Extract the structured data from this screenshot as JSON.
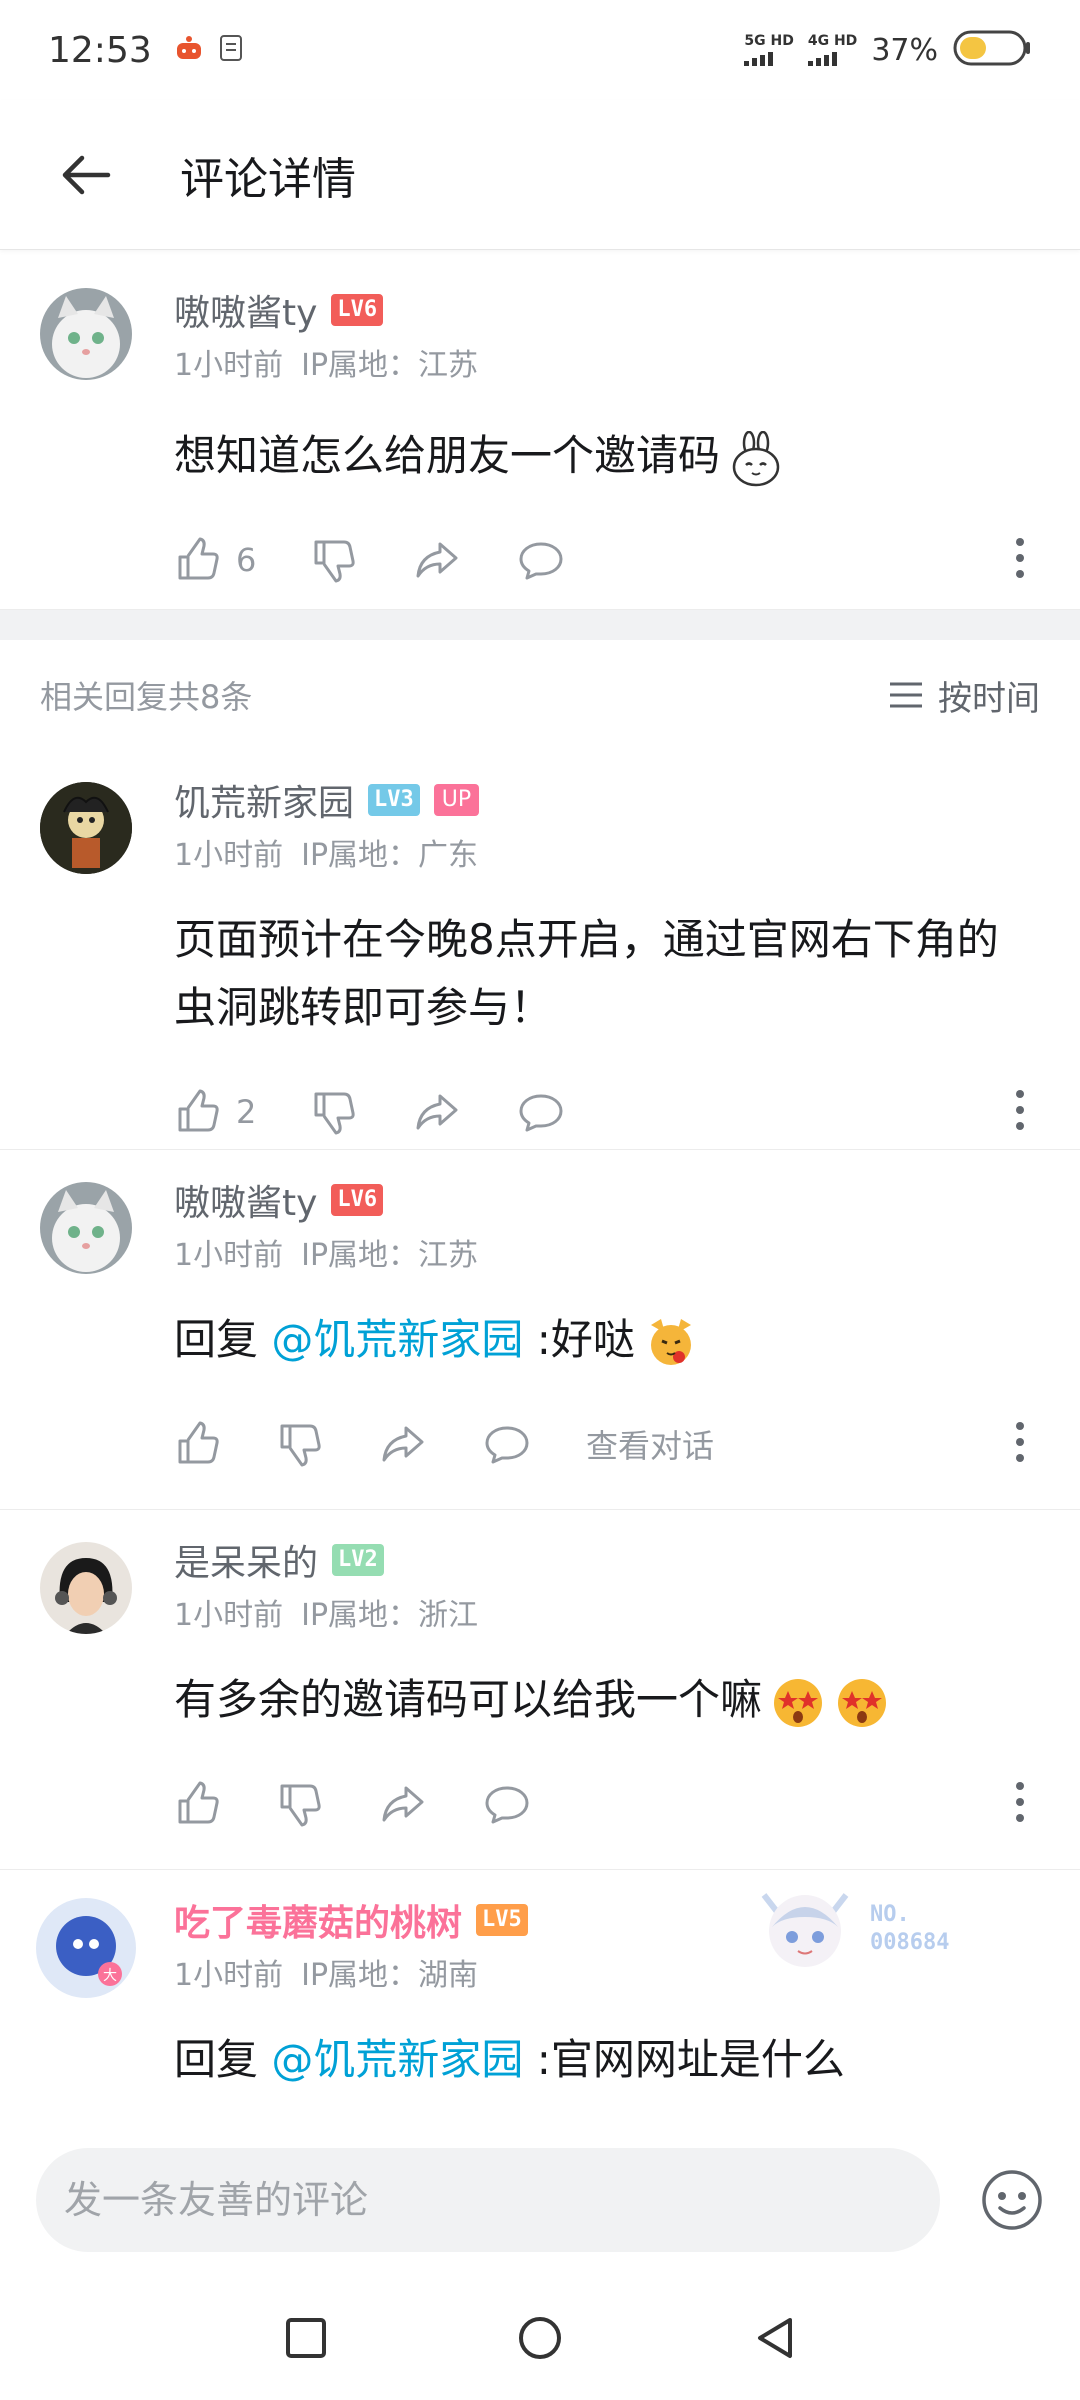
{
  "status_bar": {
    "time": "12:53",
    "sim1_label": "5G HD",
    "sim2_label": "4G HD",
    "battery": "37%"
  },
  "header": {
    "title": "评论详情",
    "back_icon": "arrow-left-icon"
  },
  "root_comment": {
    "user": "嗷嗷酱ty",
    "level": "LV6",
    "level_color": "#f25d59",
    "time": "1小时前",
    "ip": "IP属地：江苏",
    "text": "想知道怎么给朋友一个邀请码",
    "likes": "6"
  },
  "replies_header": {
    "count_text": "相关回复共8条",
    "sort_label": "按时间"
  },
  "replies": [
    {
      "user": "饥荒新家园",
      "level": "LV3",
      "level_color": "#74c9e8",
      "up_badge": "UP",
      "time": "1小时前",
      "ip": "IP属地：广东",
      "text": "页面预计在今晚8点开启，通过官网右下角的虫洞跳转即可参与！",
      "likes": "2"
    },
    {
      "user": "嗷嗷酱ty",
      "level": "LV6",
      "level_color": "#f25d59",
      "time": "1小时前",
      "ip": "IP属地：江苏",
      "reply_prefix": "回复 ",
      "mention": "@饥荒新家园",
      "text": " :好哒",
      "view_dialog": "查看对话"
    },
    {
      "user": "是呆呆的",
      "level": "LV2",
      "level_color": "#95ddb2",
      "time": "1小时前",
      "ip": "IP属地：浙江",
      "text": "有多余的邀请码可以给我一个嘛"
    },
    {
      "user": "吃了毒蘑菇的桃树",
      "level": "LV5",
      "level_color": "#ff9e4a",
      "time": "1小时前",
      "ip": "IP属地：湖南",
      "reply_prefix": "回复 ",
      "mention": "@饥荒新家园",
      "text": " :官网网址是什么",
      "badge_no_line1": "NO.",
      "badge_no_line2": "008684"
    }
  ],
  "input": {
    "placeholder": "发一条友善的评论"
  },
  "colors": {
    "accent": "#fb7299",
    "link": "#00a1d6",
    "muted": "#9499a0"
  }
}
